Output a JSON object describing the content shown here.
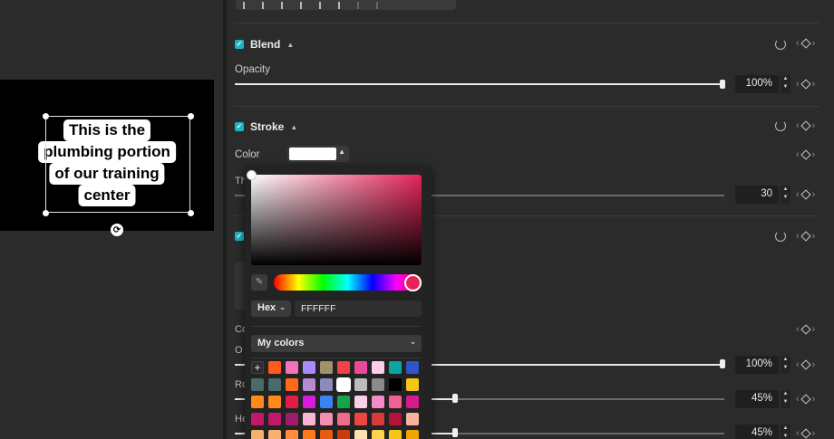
{
  "canvas": {
    "caption_lines": [
      "This is the",
      "plumbing portion",
      "of our training",
      "center"
    ]
  },
  "blend": {
    "title": "Blend",
    "opacity_label": "Opacity",
    "opacity_value": "100%",
    "opacity_fraction": 1.0
  },
  "stroke": {
    "title": "Stroke",
    "color_label": "Color",
    "color_value": "#FFFFFF",
    "thickness_label_partial": "Th",
    "thickness_value": "30"
  },
  "section3": {
    "checked": true
  },
  "lower": {
    "label_c": "Co",
    "label_o": "O",
    "opacity_value": "100%",
    "opacity_fraction": 1.0,
    "label_r": "Ro",
    "r_value": "45%",
    "r_fraction": 0.45,
    "label_h": "He",
    "h_value": "45%",
    "h_fraction": 0.45
  },
  "picker": {
    "mode_label": "Hex",
    "hex_value": "FFFFFF",
    "palette_label": "My colors",
    "add_label": "+",
    "swatches": [
      [
        "#ff5a1f",
        "#f472b6",
        "#a78bfa",
        "#a1926b",
        "#ef4444",
        "#ec4899",
        "#fbcfe8",
        "#0ea5a0",
        "#2f56c8"
      ],
      [
        "#4b6b6b",
        "#ff6a1a",
        "#b58bd1",
        "#8b8bc0",
        "#ffffff",
        "#bdbdbd",
        "#8a8a8a",
        "#000000",
        "#f5c518"
      ],
      [
        "#ff8a1a",
        "#e11d48",
        "#d81bd8",
        "#3b82f6",
        "#16a34a",
        "#fbcfe8",
        "#f58ac8",
        "#f06292",
        "#d81b8a"
      ],
      [
        "#c2186b",
        "#a01a6b",
        "#f9b4d2",
        "#f48fb1",
        "#f06a8a",
        "#ef4444",
        "#d63a3a",
        "#b3123b",
        "#f8b4a0"
      ],
      [
        "#f8b070",
        "#ff8c3a",
        "#ff7a1a",
        "#e85d0d",
        "#c93c0d",
        "#fde2b0",
        "#fcd34d",
        "#f5c518",
        "#f0a500"
      ]
    ]
  }
}
